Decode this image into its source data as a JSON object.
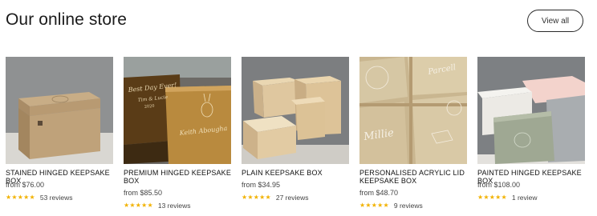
{
  "header": {
    "title": "Our online store",
    "view_all_label": "View all"
  },
  "colors": {
    "star": "#f2b200",
    "border": "#2a2a2a"
  },
  "products": [
    {
      "name": "STAINED HINGED KEEPSAKE BOX",
      "price": "from $76.00",
      "rating": 5,
      "reviews": "53 reviews",
      "stars_icon": "star-icon"
    },
    {
      "name": "PREMIUM HINGED KEEPSAKE BOX",
      "price": "from $85.50",
      "rating": 5,
      "reviews": "13 reviews",
      "stars_icon": "star-icon",
      "image_text": [
        "Best Day Ever!",
        "Tim & Lucie",
        "2020",
        "Keith Abougha"
      ]
    },
    {
      "name": "PLAIN KEEPSAKE BOX",
      "price": "from $34.95",
      "rating": 5,
      "reviews": "27 reviews",
      "stars_icon": "star-icon"
    },
    {
      "name": "PERSONALISED ACRYLIC LID KEEPSAKE BOX",
      "price": "from $48.70",
      "rating": 5,
      "reviews": "9 reviews",
      "stars_icon": "star-icon",
      "image_text": [
        "Parcell",
        "Millie"
      ]
    },
    {
      "name": "PAINTED HINGED KEEPSAKE BOX",
      "price": "from $108.00",
      "rating": 5,
      "reviews": "1 review",
      "stars_icon": "star-icon"
    }
  ]
}
